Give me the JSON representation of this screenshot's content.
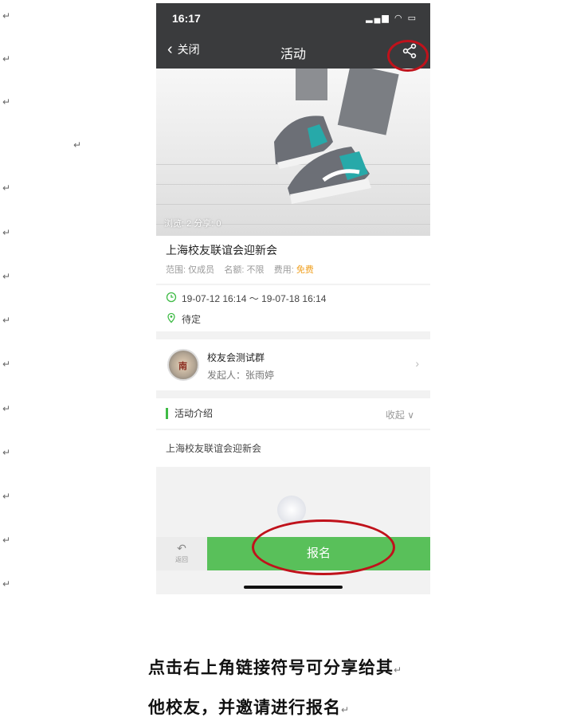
{
  "doc": {
    "paragraph_mark": "↵",
    "caption_line1": "点击右上角链接符号可分享给其",
    "caption_line2": "他校友，并邀请进行报名"
  },
  "status_bar": {
    "time": "16:17",
    "icons": "▂▄▆ ◠ ▭"
  },
  "nav": {
    "back_label": "关闭",
    "title": "活动"
  },
  "hero": {
    "stats": "浏览: 2   分享: 0"
  },
  "event": {
    "title": "上海校友联谊会迎新会",
    "scope_label": "范围:",
    "scope_value": "仅成员",
    "quota_label": "名额:",
    "quota_value": "不限",
    "fee_label": "费用:",
    "fee_value": "免费",
    "time_range": "19-07-12 16:14 ～ 19-07-18 16:14",
    "location": "待定"
  },
  "organizer": {
    "group_name": "校友会测试群",
    "initiator": "发起人：张雨婷",
    "avatar_text": "南"
  },
  "intro": {
    "heading": "活动介绍",
    "collapse_label": "收起 ∨",
    "body": "上海校友联谊会迎新会"
  },
  "bottom": {
    "back_label": "返回",
    "signup_label": "报名"
  },
  "colors": {
    "header": "#3a3b3d",
    "accent_green": "#59c05a",
    "highlight_red": "#c0121b",
    "fee_orange": "#f0a020"
  }
}
